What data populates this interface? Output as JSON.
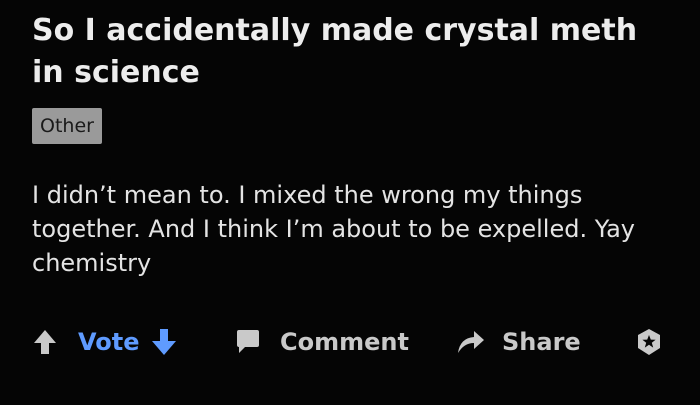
{
  "post": {
    "title": "So I accidentally made crystal meth in science",
    "flair": "Other",
    "body": "I didn’t mean to. I mixed the wrong my things together. And I think I’m about to be expelled. Yay chemistry"
  },
  "actions": {
    "vote_label": "Vote",
    "comment_label": "Comment",
    "share_label": "Share"
  },
  "icons": {
    "upvote": "arrow-up-icon",
    "downvote": "arrow-down-icon",
    "comment": "comment-icon",
    "share": "share-icon",
    "award": "award-icon"
  },
  "colors": {
    "background": "#050505",
    "vote_accent": "#5f9bff",
    "action_text": "#c9c9c9",
    "flair_bg": "#9a9a9a"
  }
}
